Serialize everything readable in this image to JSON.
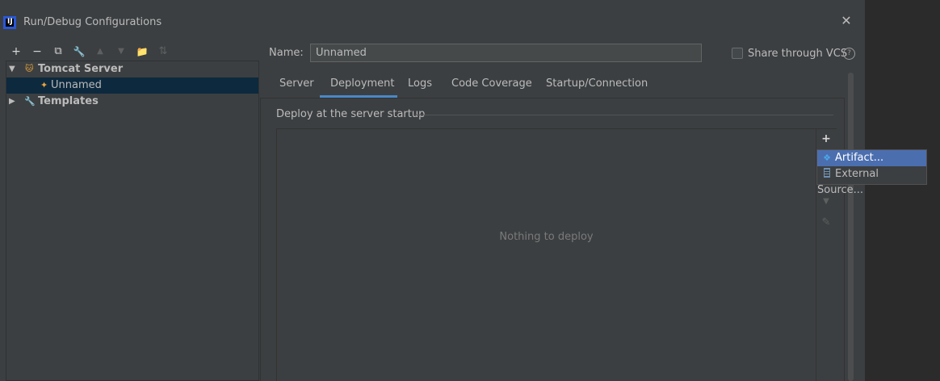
{
  "window": {
    "title": "Run/Debug Configurations",
    "app_icon_text": "IJ",
    "close_glyph": "✕"
  },
  "toolbar": {
    "icons": [
      {
        "name": "add-icon",
        "glyph": "+",
        "enabled": true
      },
      {
        "name": "remove-icon",
        "glyph": "−",
        "enabled": true
      },
      {
        "name": "copy-icon",
        "glyph": "⧉",
        "enabled": true
      },
      {
        "name": "wrench-icon",
        "glyph": "🔧",
        "enabled": true
      },
      {
        "name": "move-up-icon",
        "glyph": "▲",
        "enabled": false
      },
      {
        "name": "move-down-icon",
        "glyph": "▼",
        "enabled": false
      },
      {
        "name": "folder-icon",
        "glyph": "📁",
        "enabled": true
      },
      {
        "name": "sort-icon",
        "glyph": "⇅",
        "enabled": false
      }
    ]
  },
  "tree": {
    "items": [
      {
        "label": "Tomcat Server",
        "expanded": true,
        "bold": true,
        "icon": "tomcat-icon",
        "glyph": "🐱"
      },
      {
        "label": "Unnamed",
        "selected": true,
        "icon": "tomcat-run-icon",
        "glyph": "✦"
      },
      {
        "label": "Templates",
        "expanded": false,
        "bold": true,
        "icon": "wrench-icon",
        "glyph": "🔧"
      }
    ]
  },
  "form": {
    "name_label": "Name:",
    "name_value": "Unnamed",
    "share_vcs_label": "Share through VCS",
    "share_vcs_checked": false,
    "help_glyph": "?"
  },
  "tabs": [
    {
      "label": "Server",
      "active": false
    },
    {
      "label": "Deployment",
      "active": true
    },
    {
      "label": "Logs",
      "active": false
    },
    {
      "label": "Code Coverage",
      "active": false
    },
    {
      "label": "Startup/Connection",
      "active": false
    }
  ],
  "deployment": {
    "section_title": "Deploy at the server startup",
    "empty_text": "Nothing to deploy",
    "add_glyph": "+",
    "down_glyph": "▼",
    "edit_glyph": "✎"
  },
  "add_menu": {
    "items": [
      {
        "label": "Artifact...",
        "icon": "artifact-icon",
        "selected": true
      },
      {
        "label": "External Source...",
        "icon": "external-source-icon",
        "selected": false
      }
    ]
  },
  "colors": {
    "dialog_bg": "#3c3f41",
    "selection_tree": "#0d293e",
    "selection_menu": "#4b6eaf",
    "tab_underline": "#4a88c7"
  }
}
